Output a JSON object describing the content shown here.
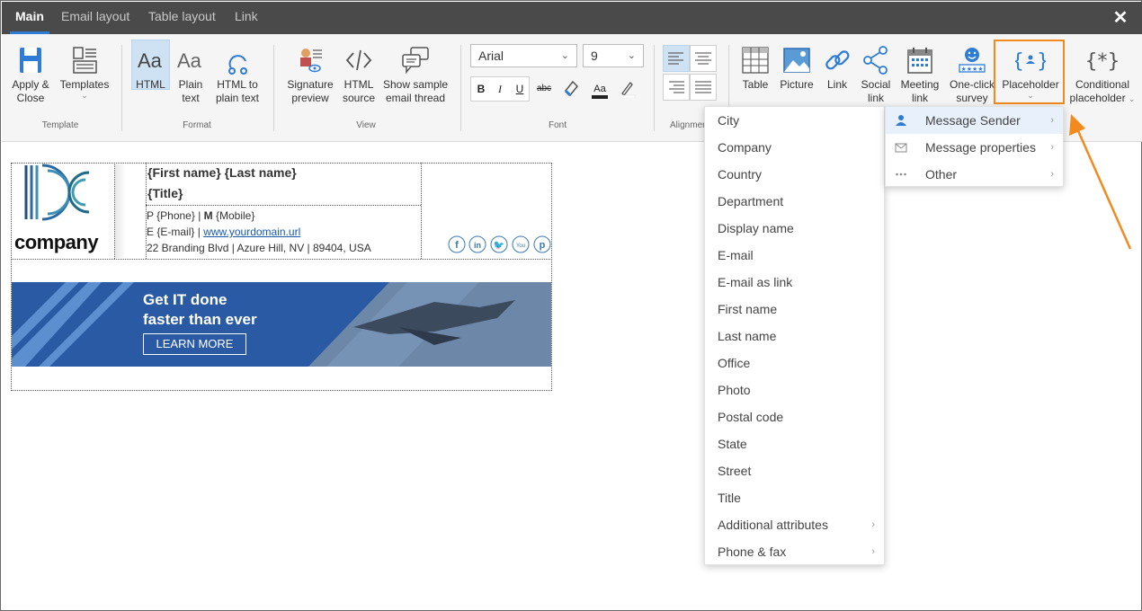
{
  "tabs": [
    {
      "label": "Main"
    },
    {
      "label": "Email layout"
    },
    {
      "label": "Table layout"
    },
    {
      "label": "Link"
    }
  ],
  "close_label": "✕",
  "ribbon": {
    "template": {
      "group": "Template",
      "apply_close": [
        "Apply &",
        "Close"
      ],
      "templates": "Templates"
    },
    "format": {
      "group": "Format",
      "html": "HTML",
      "plain_text": [
        "Plain",
        "text"
      ],
      "html_to_plain": [
        "HTML to",
        "plain text"
      ]
    },
    "view": {
      "group": "View",
      "signature_preview": [
        "Signature",
        "preview"
      ],
      "html_source": [
        "HTML",
        "source"
      ],
      "show_sample": [
        "Show sample",
        "email thread"
      ]
    },
    "font": {
      "group": "Font",
      "family": "Arial",
      "size": "9",
      "bold": "B",
      "italic": "I",
      "underline": "U",
      "strike": "abc",
      "color": "Aa"
    },
    "alignment": {
      "group": "Alignment"
    },
    "insert": {
      "table": "Table",
      "picture": "Picture",
      "link": "Link",
      "social_link": [
        "Social",
        "link"
      ],
      "meeting_link": [
        "Meeting",
        "link"
      ],
      "survey": [
        "One-click",
        "survey"
      ],
      "placeholder": "Placeholder",
      "conditional": [
        "Conditional",
        "placeholder"
      ]
    }
  },
  "signature": {
    "logo_text": "company",
    "name_line": "{First name} {Last name}",
    "title_line": "{Title}",
    "phone_prefix": "P",
    "phone": "{Phone}",
    "mobile_prefix": "M",
    "mobile": "{Mobile}",
    "email_prefix": "E",
    "email": "{E-mail}",
    "website": "www.yourdomain.url",
    "address": "22 Branding Blvd | Azure Hill, NV | 89404, USA",
    "banner_line1": "Get IT done",
    "banner_line2": "faster than ever",
    "banner_button": "LEARN MORE"
  },
  "placeholder_menu": [
    {
      "label": "City"
    },
    {
      "label": "Company"
    },
    {
      "label": "Country"
    },
    {
      "label": "Department"
    },
    {
      "label": "Display name"
    },
    {
      "label": "E-mail"
    },
    {
      "label": "E-mail as link"
    },
    {
      "label": "First name"
    },
    {
      "label": "Last name"
    },
    {
      "label": "Office"
    },
    {
      "label": "Photo"
    },
    {
      "label": "Postal code"
    },
    {
      "label": "State"
    },
    {
      "label": "Street"
    },
    {
      "label": "Title"
    },
    {
      "label": "Additional attributes"
    },
    {
      "label": "Phone & fax"
    }
  ],
  "submenu": [
    {
      "label": "Message Sender"
    },
    {
      "label": "Message properties"
    },
    {
      "label": "Other"
    }
  ],
  "colors": {
    "accent": "#2e7cd6",
    "highlight": "#f28a1e",
    "tabbar": "#4a4a4a",
    "banner": "#2a5aa3"
  }
}
